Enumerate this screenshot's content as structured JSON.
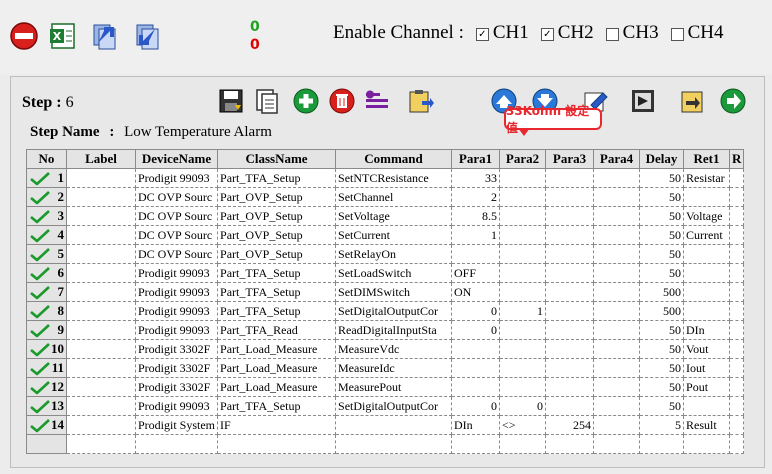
{
  "counters": {
    "green": "0",
    "red": "0"
  },
  "enable": {
    "label": "Enable Channel :",
    "channels": [
      {
        "name": "CH1",
        "checked": true
      },
      {
        "name": "CH2",
        "checked": true
      },
      {
        "name": "CH3",
        "checked": false
      },
      {
        "name": "CH4",
        "checked": false
      }
    ]
  },
  "step": {
    "label": "Step :",
    "value": "6"
  },
  "step_name": {
    "label": "Step Name",
    "sep": ":",
    "value": "Low Temperature Alarm"
  },
  "tooltip": "33Kohm 設定值",
  "columns": [
    "No",
    "Label",
    "DeviceName",
    "ClassName",
    "Command",
    "Para1",
    "Para2",
    "Para3",
    "Para4",
    "Delay",
    "Ret1",
    "R"
  ],
  "rows": [
    {
      "no": "1",
      "label": "",
      "device": "Prodigit 99093",
      "class": "Part_TFA_Setup",
      "command": "SetNTCResistance",
      "p1": "33",
      "p2": "",
      "p3": "",
      "p4": "",
      "delay": "50",
      "ret1": "Resistar"
    },
    {
      "no": "2",
      "label": "",
      "device": "DC OVP Sourc",
      "class": "Part_OVP_Setup",
      "command": "SetChannel",
      "p1": "2",
      "p2": "",
      "p3": "",
      "p4": "",
      "delay": "50",
      "ret1": ""
    },
    {
      "no": "3",
      "label": "",
      "device": "DC OVP Sourc",
      "class": "Part_OVP_Setup",
      "command": "SetVoltage",
      "p1": "8.5",
      "p2": "",
      "p3": "",
      "p4": "",
      "delay": "50",
      "ret1": "Voltage"
    },
    {
      "no": "4",
      "label": "",
      "device": "DC OVP Sourc",
      "class": "Part_OVP_Setup",
      "command": "SetCurrent",
      "p1": "1",
      "p2": "",
      "p3": "",
      "p4": "",
      "delay": "50",
      "ret1": "Current"
    },
    {
      "no": "5",
      "label": "",
      "device": "DC OVP Sourc",
      "class": "Part_OVP_Setup",
      "command": "SetRelayOn",
      "p1": "",
      "p2": "",
      "p3": "",
      "p4": "",
      "delay": "50",
      "ret1": ""
    },
    {
      "no": "6",
      "label": "",
      "device": "Prodigit 99093",
      "class": "Part_TFA_Setup",
      "command": "SetLoadSwitch",
      "p1": "OFF",
      "p2": "",
      "p3": "",
      "p4": "",
      "delay": "50",
      "ret1": ""
    },
    {
      "no": "7",
      "label": "",
      "device": "Prodigit 99093",
      "class": "Part_TFA_Setup",
      "command": "SetDIMSwitch",
      "p1": "ON",
      "p2": "",
      "p3": "",
      "p4": "",
      "delay": "500",
      "ret1": ""
    },
    {
      "no": "8",
      "label": "",
      "device": "Prodigit 99093",
      "class": "Part_TFA_Setup",
      "command": "SetDigitalOutputCor",
      "p1": "0",
      "p2": "1",
      "p3": "",
      "p4": "",
      "delay": "500",
      "ret1": ""
    },
    {
      "no": "9",
      "label": "",
      "device": "Prodigit 99093",
      "class": "Part_TFA_Read",
      "command": "ReadDigitalInputSta",
      "p1": "0",
      "p2": "",
      "p3": "",
      "p4": "",
      "delay": "50",
      "ret1": "DIn"
    },
    {
      "no": "10",
      "label": "",
      "device": "Prodigit 3302F",
      "class": "Part_Load_Measure",
      "command": "MeasureVdc",
      "p1": "",
      "p2": "",
      "p3": "",
      "p4": "",
      "delay": "50",
      "ret1": "Vout"
    },
    {
      "no": "11",
      "label": "",
      "device": "Prodigit 3302F",
      "class": "Part_Load_Measure",
      "command": "MeasureIdc",
      "p1": "",
      "p2": "",
      "p3": "",
      "p4": "",
      "delay": "50",
      "ret1": "Iout"
    },
    {
      "no": "12",
      "label": "",
      "device": "Prodigit 3302F",
      "class": "Part_Load_Measure",
      "command": "MeasurePout",
      "p1": "",
      "p2": "",
      "p3": "",
      "p4": "",
      "delay": "50",
      "ret1": "Pout"
    },
    {
      "no": "13",
      "label": "",
      "device": "Prodigit 99093",
      "class": "Part_TFA_Setup",
      "command": "SetDigitalOutputCor",
      "p1": "0",
      "p2": "0",
      "p3": "",
      "p4": "",
      "delay": "50",
      "ret1": ""
    },
    {
      "no": "14",
      "label": "",
      "device": "Prodigit System",
      "class": "IF",
      "command": "",
      "p1": "DIn",
      "p2": "<>",
      "p3": "254",
      "p4": "",
      "delay": "5",
      "ret1": "Result"
    }
  ],
  "colors": {
    "check": "#1a9a2a",
    "accent_red": "#e8282e",
    "counter_green": "#1fa31f",
    "counter_red": "#e00000"
  }
}
